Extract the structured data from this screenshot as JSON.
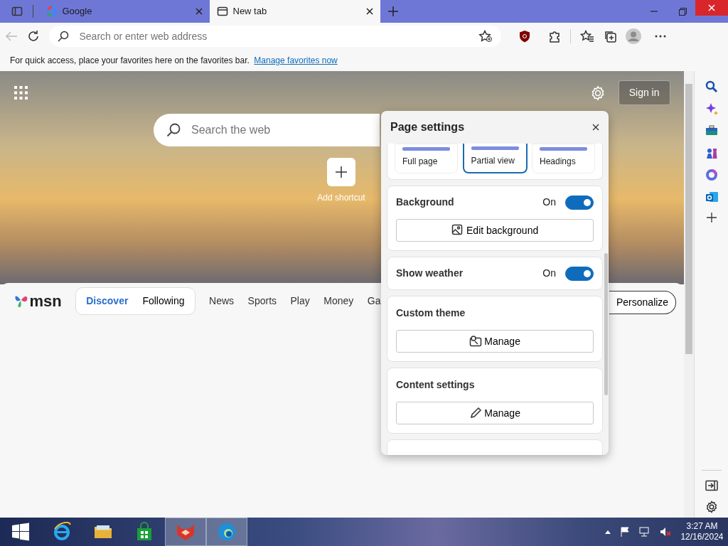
{
  "browser_tabs": [
    {
      "label": "Google",
      "selected": false
    },
    {
      "label": "New tab",
      "selected": true
    }
  ],
  "address_bar": {
    "placeholder": "Search or enter web address"
  },
  "favorites_bar": {
    "message": "For quick access, place your favorites here on the favorites bar.",
    "link": "Manage favorites now"
  },
  "new_tab": {
    "sign_in": "Sign in",
    "search": {
      "placeholder": "Search the web"
    },
    "shortcut": {
      "label": "Add shortcut"
    }
  },
  "msn_nav": {
    "logo": "msn",
    "pills": [
      {
        "label": "Discover",
        "selected": true
      },
      {
        "label": "Following",
        "selected": false
      }
    ],
    "links": [
      "News",
      "Sports",
      "Play",
      "Money",
      "Ga"
    ],
    "personalize": "Personalize"
  },
  "page_settings": {
    "title": "Page settings",
    "layouts": [
      {
        "label": "Full page",
        "selected": false
      },
      {
        "label": "Partial view",
        "selected": true
      },
      {
        "label": "Headings",
        "selected": false
      }
    ],
    "sections": [
      {
        "kind": "toggle_button",
        "title": "Background",
        "state_label": "On",
        "on": true,
        "button": "Edit background"
      },
      {
        "kind": "toggle",
        "title": "Show weather",
        "state_label": "On",
        "on": true
      },
      {
        "kind": "button",
        "title": "Custom theme",
        "button": "Manage"
      },
      {
        "kind": "button",
        "title": "Content settings",
        "button": "Manage"
      }
    ]
  },
  "taskbar": {
    "time": "3:27 AM",
    "date": "12/16/2024"
  }
}
